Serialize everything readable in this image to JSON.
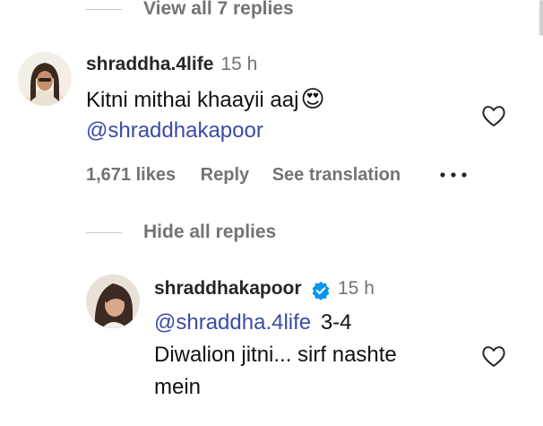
{
  "thread1": {
    "toggle_label": "View all 7 replies"
  },
  "comment1": {
    "username": "shraddha.4life",
    "time": "15 h",
    "text": "Kitni mithai khaayii aaj",
    "emoji": "😍",
    "mention": "@shraddhakapoor",
    "likes": "1,671 likes",
    "reply_label": "Reply",
    "translate_label": "See translation"
  },
  "thread2": {
    "toggle_label": "Hide all replies"
  },
  "reply1": {
    "username": "shraddhakapoor",
    "time": "15 h",
    "mention": "@shraddha.4life",
    "text_line1": "3-4",
    "text_line2": "Diwalion jitni... sirf nashte",
    "text_line3": "mein"
  },
  "icons": {
    "heart": "heart-outline-icon",
    "verified": "verified-badge-icon",
    "more": "more-options-icon"
  },
  "colors": {
    "mention": "#3b4ba3",
    "muted": "#737373",
    "verified": "#0095f6"
  }
}
